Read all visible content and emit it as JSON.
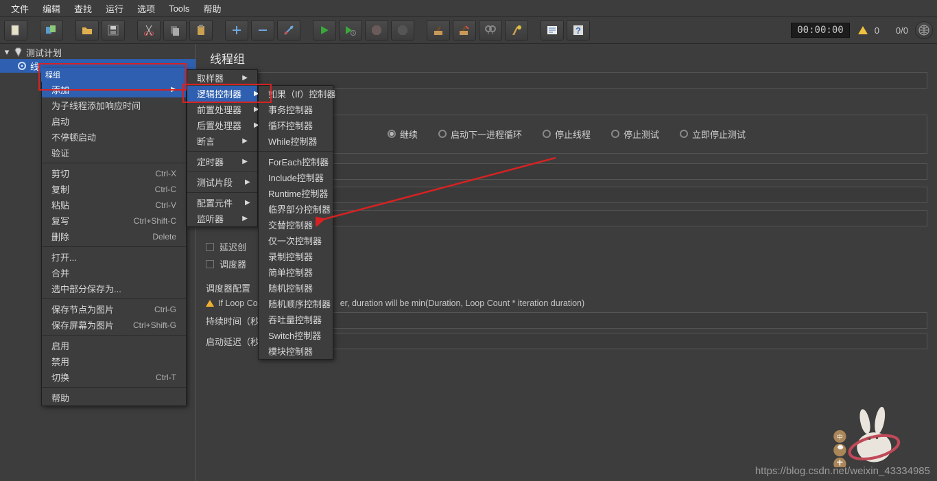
{
  "menubar": {
    "file": "文件",
    "edit": "编辑",
    "search": "查找",
    "run": "运行",
    "options": "选项",
    "tools": "Tools",
    "help": "帮助"
  },
  "status": {
    "timer": "00:00:00",
    "warn_count": "0",
    "ratio": "0/0"
  },
  "tree": {
    "root": "测试计划",
    "thread_prefix": "线",
    "thread_badge": "程组"
  },
  "panel": {
    "title": "线程组",
    "radios": {
      "cont": "继续",
      "next": "启动下一进程循环",
      "stop_thread": "停止线程",
      "stop_test": "停止测试",
      "stop_now": "立即停止测试"
    },
    "sched_label": "调度器配置",
    "loop_note": "If Loop Co",
    "dur_tail": "er, duration will be min(Duration, Loop Count * iteration duration)",
    "duration_label": "持续时间（秒",
    "delay_label": "启动延迟（秒",
    "delay_chk": "延迟创",
    "sched_chk": "调度器"
  },
  "ctx1": {
    "add": "添加",
    "add_think": "为子线程添加响应时间",
    "start": "启动",
    "start_no_pause": "不停顿启动",
    "validate": "验证",
    "cut": "剪切",
    "cut_k": "Ctrl-X",
    "copy": "复制",
    "copy_k": "Ctrl-C",
    "paste": "粘贴",
    "paste_k": "Ctrl-V",
    "dup": "复写",
    "dup_k": "Ctrl+Shift-C",
    "del": "删除",
    "del_k": "Delete",
    "open": "打开...",
    "merge": "合并",
    "save_sel": "选中部分保存为...",
    "save_node": "保存节点为图片",
    "save_node_k": "Ctrl-G",
    "save_screen": "保存屏幕为图片",
    "save_screen_k": "Ctrl+Shift-G",
    "enable": "启用",
    "disable": "禁用",
    "toggle": "切换",
    "toggle_k": "Ctrl-T",
    "help": "帮助"
  },
  "ctx2": {
    "sampler": "取样器",
    "logic": "逻辑控制器",
    "pre": "前置处理器",
    "post": "后置处理器",
    "assert": "断言",
    "timer": "定时器",
    "frag": "测试片段",
    "config": "配置元件",
    "listener": "监听器"
  },
  "ctx3": {
    "if": "如果（If）控制器",
    "tx": "事务控制器",
    "loop": "循环控制器",
    "while": "While控制器",
    "foreach": "ForEach控制器",
    "include": "Include控制器",
    "runtime": "Runtime控制器",
    "critical": "临界部分控制器",
    "interleave": "交替控制器",
    "once": "仅一次控制器",
    "rec": "录制控制器",
    "simple": "简单控制器",
    "random": "随机控制器",
    "random_order": "随机顺序控制器",
    "throughput": "吞吐量控制器",
    "switch": "Switch控制器",
    "module": "模块控制器"
  },
  "watermark": "https://blog.csdn.net/weixin_43334985"
}
